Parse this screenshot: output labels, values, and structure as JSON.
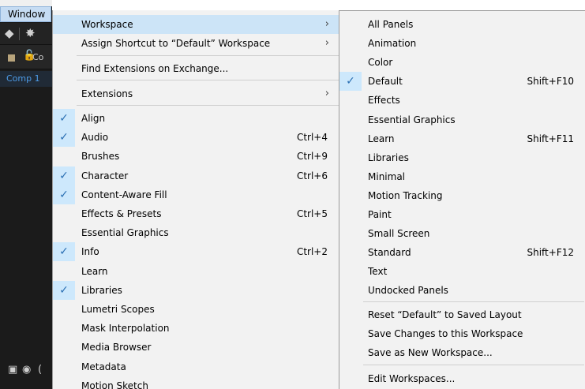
{
  "menubar": {
    "window_label": "Window"
  },
  "layer": {
    "name_fragment": "Co"
  },
  "comp_tab": {
    "label": "Comp 1"
  },
  "bottom_fragment": "(",
  "window_menu": {
    "top_items": [
      {
        "label": "Workspace",
        "has_submenu": true,
        "highlighted": true
      },
      {
        "label": "Assign Shortcut to “Default” Workspace",
        "has_submenu": true
      },
      {
        "label": "Find Extensions on Exchange..."
      },
      {
        "label": "Extensions",
        "has_submenu": true
      }
    ],
    "panel_items": [
      {
        "label": "Align",
        "checked": true,
        "shortcut": ""
      },
      {
        "label": "Audio",
        "checked": true,
        "shortcut": "Ctrl+4"
      },
      {
        "label": "Brushes",
        "checked": false,
        "shortcut": "Ctrl+9"
      },
      {
        "label": "Character",
        "checked": true,
        "shortcut": "Ctrl+6"
      },
      {
        "label": "Content-Aware Fill",
        "checked": true,
        "shortcut": ""
      },
      {
        "label": "Effects & Presets",
        "checked": false,
        "shortcut": "Ctrl+5"
      },
      {
        "label": "Essential Graphics",
        "checked": false,
        "shortcut": ""
      },
      {
        "label": "Info",
        "checked": true,
        "shortcut": "Ctrl+2"
      },
      {
        "label": "Learn",
        "checked": false,
        "shortcut": ""
      },
      {
        "label": "Libraries",
        "checked": true,
        "shortcut": ""
      },
      {
        "label": "Lumetri Scopes",
        "checked": false,
        "shortcut": ""
      },
      {
        "label": "Mask Interpolation",
        "checked": false,
        "shortcut": ""
      },
      {
        "label": "Media Browser",
        "checked": false,
        "shortcut": ""
      },
      {
        "label": "Metadata",
        "checked": false,
        "shortcut": ""
      },
      {
        "label": "Motion Sketch",
        "checked": false,
        "shortcut": ""
      }
    ]
  },
  "workspace_submenu": {
    "workspaces": [
      {
        "label": "All Panels",
        "checked": false,
        "shortcut": ""
      },
      {
        "label": "Animation",
        "checked": false,
        "shortcut": ""
      },
      {
        "label": "Color",
        "checked": false,
        "shortcut": ""
      },
      {
        "label": "Default",
        "checked": true,
        "shortcut": "Shift+F10"
      },
      {
        "label": "Effects",
        "checked": false,
        "shortcut": ""
      },
      {
        "label": "Essential Graphics",
        "checked": false,
        "shortcut": ""
      },
      {
        "label": "Learn",
        "checked": false,
        "shortcut": "Shift+F11"
      },
      {
        "label": "Libraries",
        "checked": false,
        "shortcut": ""
      },
      {
        "label": "Minimal",
        "checked": false,
        "shortcut": ""
      },
      {
        "label": "Motion Tracking",
        "checked": false,
        "shortcut": ""
      },
      {
        "label": "Paint",
        "checked": false,
        "shortcut": ""
      },
      {
        "label": "Small Screen",
        "checked": false,
        "shortcut": ""
      },
      {
        "label": "Standard",
        "checked": false,
        "shortcut": "Shift+F12"
      },
      {
        "label": "Text",
        "checked": false,
        "shortcut": ""
      },
      {
        "label": "Undocked Panels",
        "checked": false,
        "shortcut": ""
      }
    ],
    "actions": [
      {
        "label": "Reset “Default” to Saved Layout"
      },
      {
        "label": "Save Changes to this Workspace"
      },
      {
        "label": "Save as New Workspace..."
      }
    ],
    "edit": {
      "label": "Edit Workspaces..."
    }
  },
  "icons": {
    "check": "check-icon",
    "submenu_arrow": "chevron-right-icon",
    "scroll_up": "scroll-up-arrow-icon"
  },
  "colors": {
    "menu_bg": "#f2f2f2",
    "highlight": "#cce4f7",
    "check_column": "#cde8fc",
    "app_dark": "#1b1b1b",
    "comp_tab_text": "#4d9be6"
  }
}
